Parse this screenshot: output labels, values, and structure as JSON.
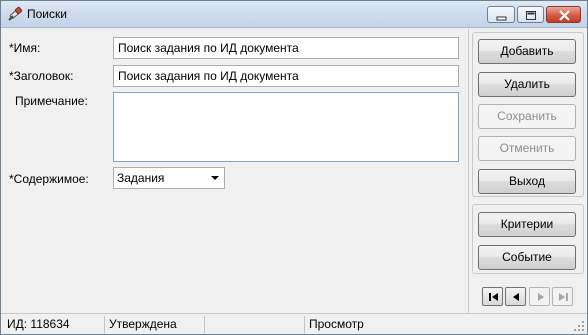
{
  "window": {
    "title": "Поиски",
    "app_icon": "search-flashlight-icon"
  },
  "form": {
    "name_label": "*Имя:",
    "name_value": "Поиск задания по ИД документа",
    "caption_label": "*Заголовок:",
    "caption_value": "Поиск задания по ИД документа",
    "note_label": "Примечание:",
    "note_value": "",
    "content_label": "*Содержимое:",
    "content_value": "Задания"
  },
  "buttons": {
    "add": "Добавить",
    "delete": "Удалить",
    "save": "Сохранить",
    "cancel": "Отменить",
    "exit": "Выход",
    "criteria": "Критерии",
    "event": "Событие"
  },
  "nav_icons": [
    "first-record-icon",
    "previous-record-icon",
    "next-record-icon",
    "last-record-icon"
  ],
  "status": {
    "id": "ИД: 118634",
    "state": "Утверждена",
    "empty": "",
    "mode": "Просмотр"
  }
}
